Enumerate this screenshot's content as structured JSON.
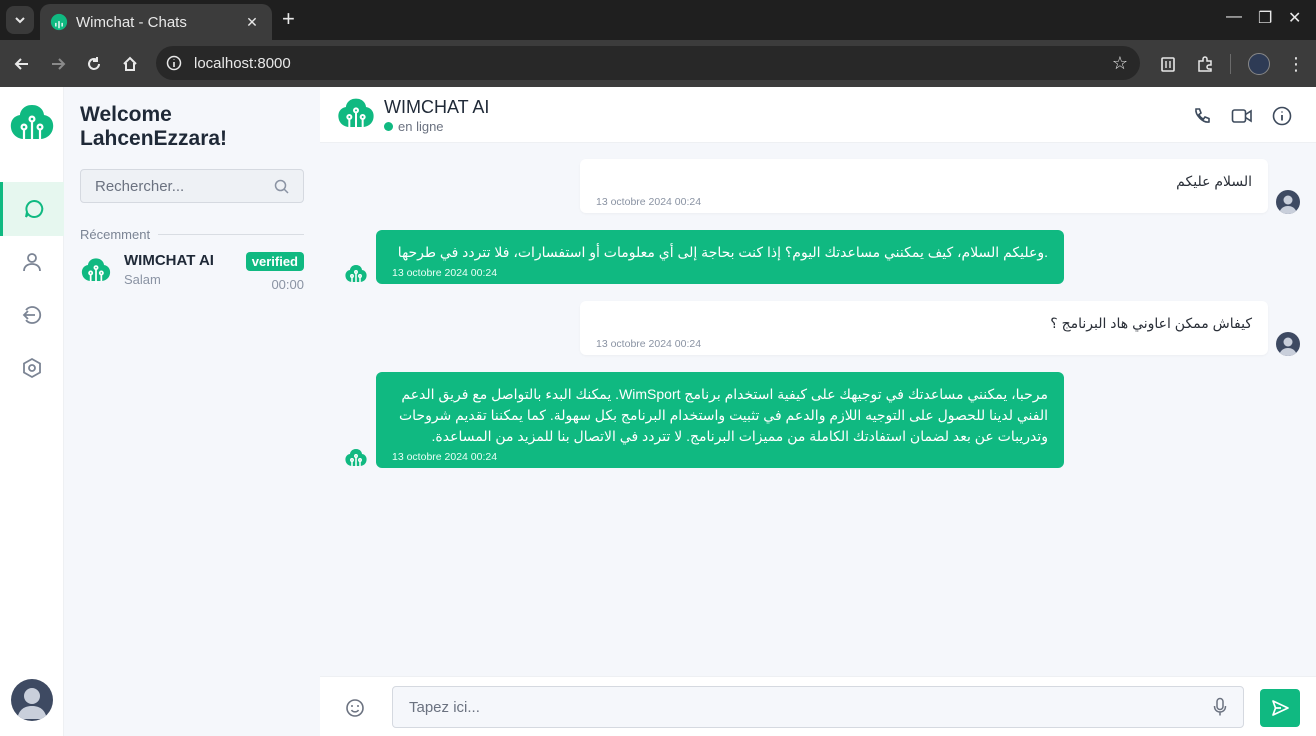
{
  "browser": {
    "tab_title": "Wimchat - Chats",
    "url": "localhost:8000"
  },
  "sidebar": {
    "welcome": "Welcome LahcenEzzara!",
    "search_placeholder": "Rechercher...",
    "recent_label": "Récemment",
    "chats": [
      {
        "name": "WIMCHAT AI",
        "last_message": "Salam",
        "badge": "verified",
        "time": "00:00"
      }
    ]
  },
  "header": {
    "name": "WIMCHAT AI",
    "status": "en ligne"
  },
  "messages": [
    {
      "sender": "user",
      "text": "السلام عليكم",
      "time": "13 octobre 2024 00:24"
    },
    {
      "sender": "bot",
      "text": ".وعليكم السلام، كيف يمكنني مساعدتك اليوم؟ إذا كنت بحاجة إلى أي معلومات أو استفسارات، فلا تتردد في طرحها",
      "time": "13 octobre 2024 00:24"
    },
    {
      "sender": "user",
      "text": "كيفاش ممكن اعاوني هاد البرنامج ؟",
      "time": "13 octobre 2024 00:24"
    },
    {
      "sender": "bot",
      "text": "مرحبا، يمكنني مساعدتك في توجيهك على كيفية استخدام برنامج WimSport. يمكنك البدء بالتواصل مع فريق الدعم الفني لدينا للحصول على التوجيه اللازم والدعم في تثبيت واستخدام البرنامج بكل سهولة. كما يمكننا تقديم شروحات وتدريبات عن بعد لضمان استفادتك الكاملة من مميزات البرنامج. لا تتردد في الاتصال بنا للمزيد من المساعدة.",
      "time": "13 octobre 2024 00:24"
    }
  ],
  "composer": {
    "placeholder": "Tapez ici..."
  },
  "colors": {
    "accent": "#10b981",
    "background": "#f5f7fb"
  }
}
